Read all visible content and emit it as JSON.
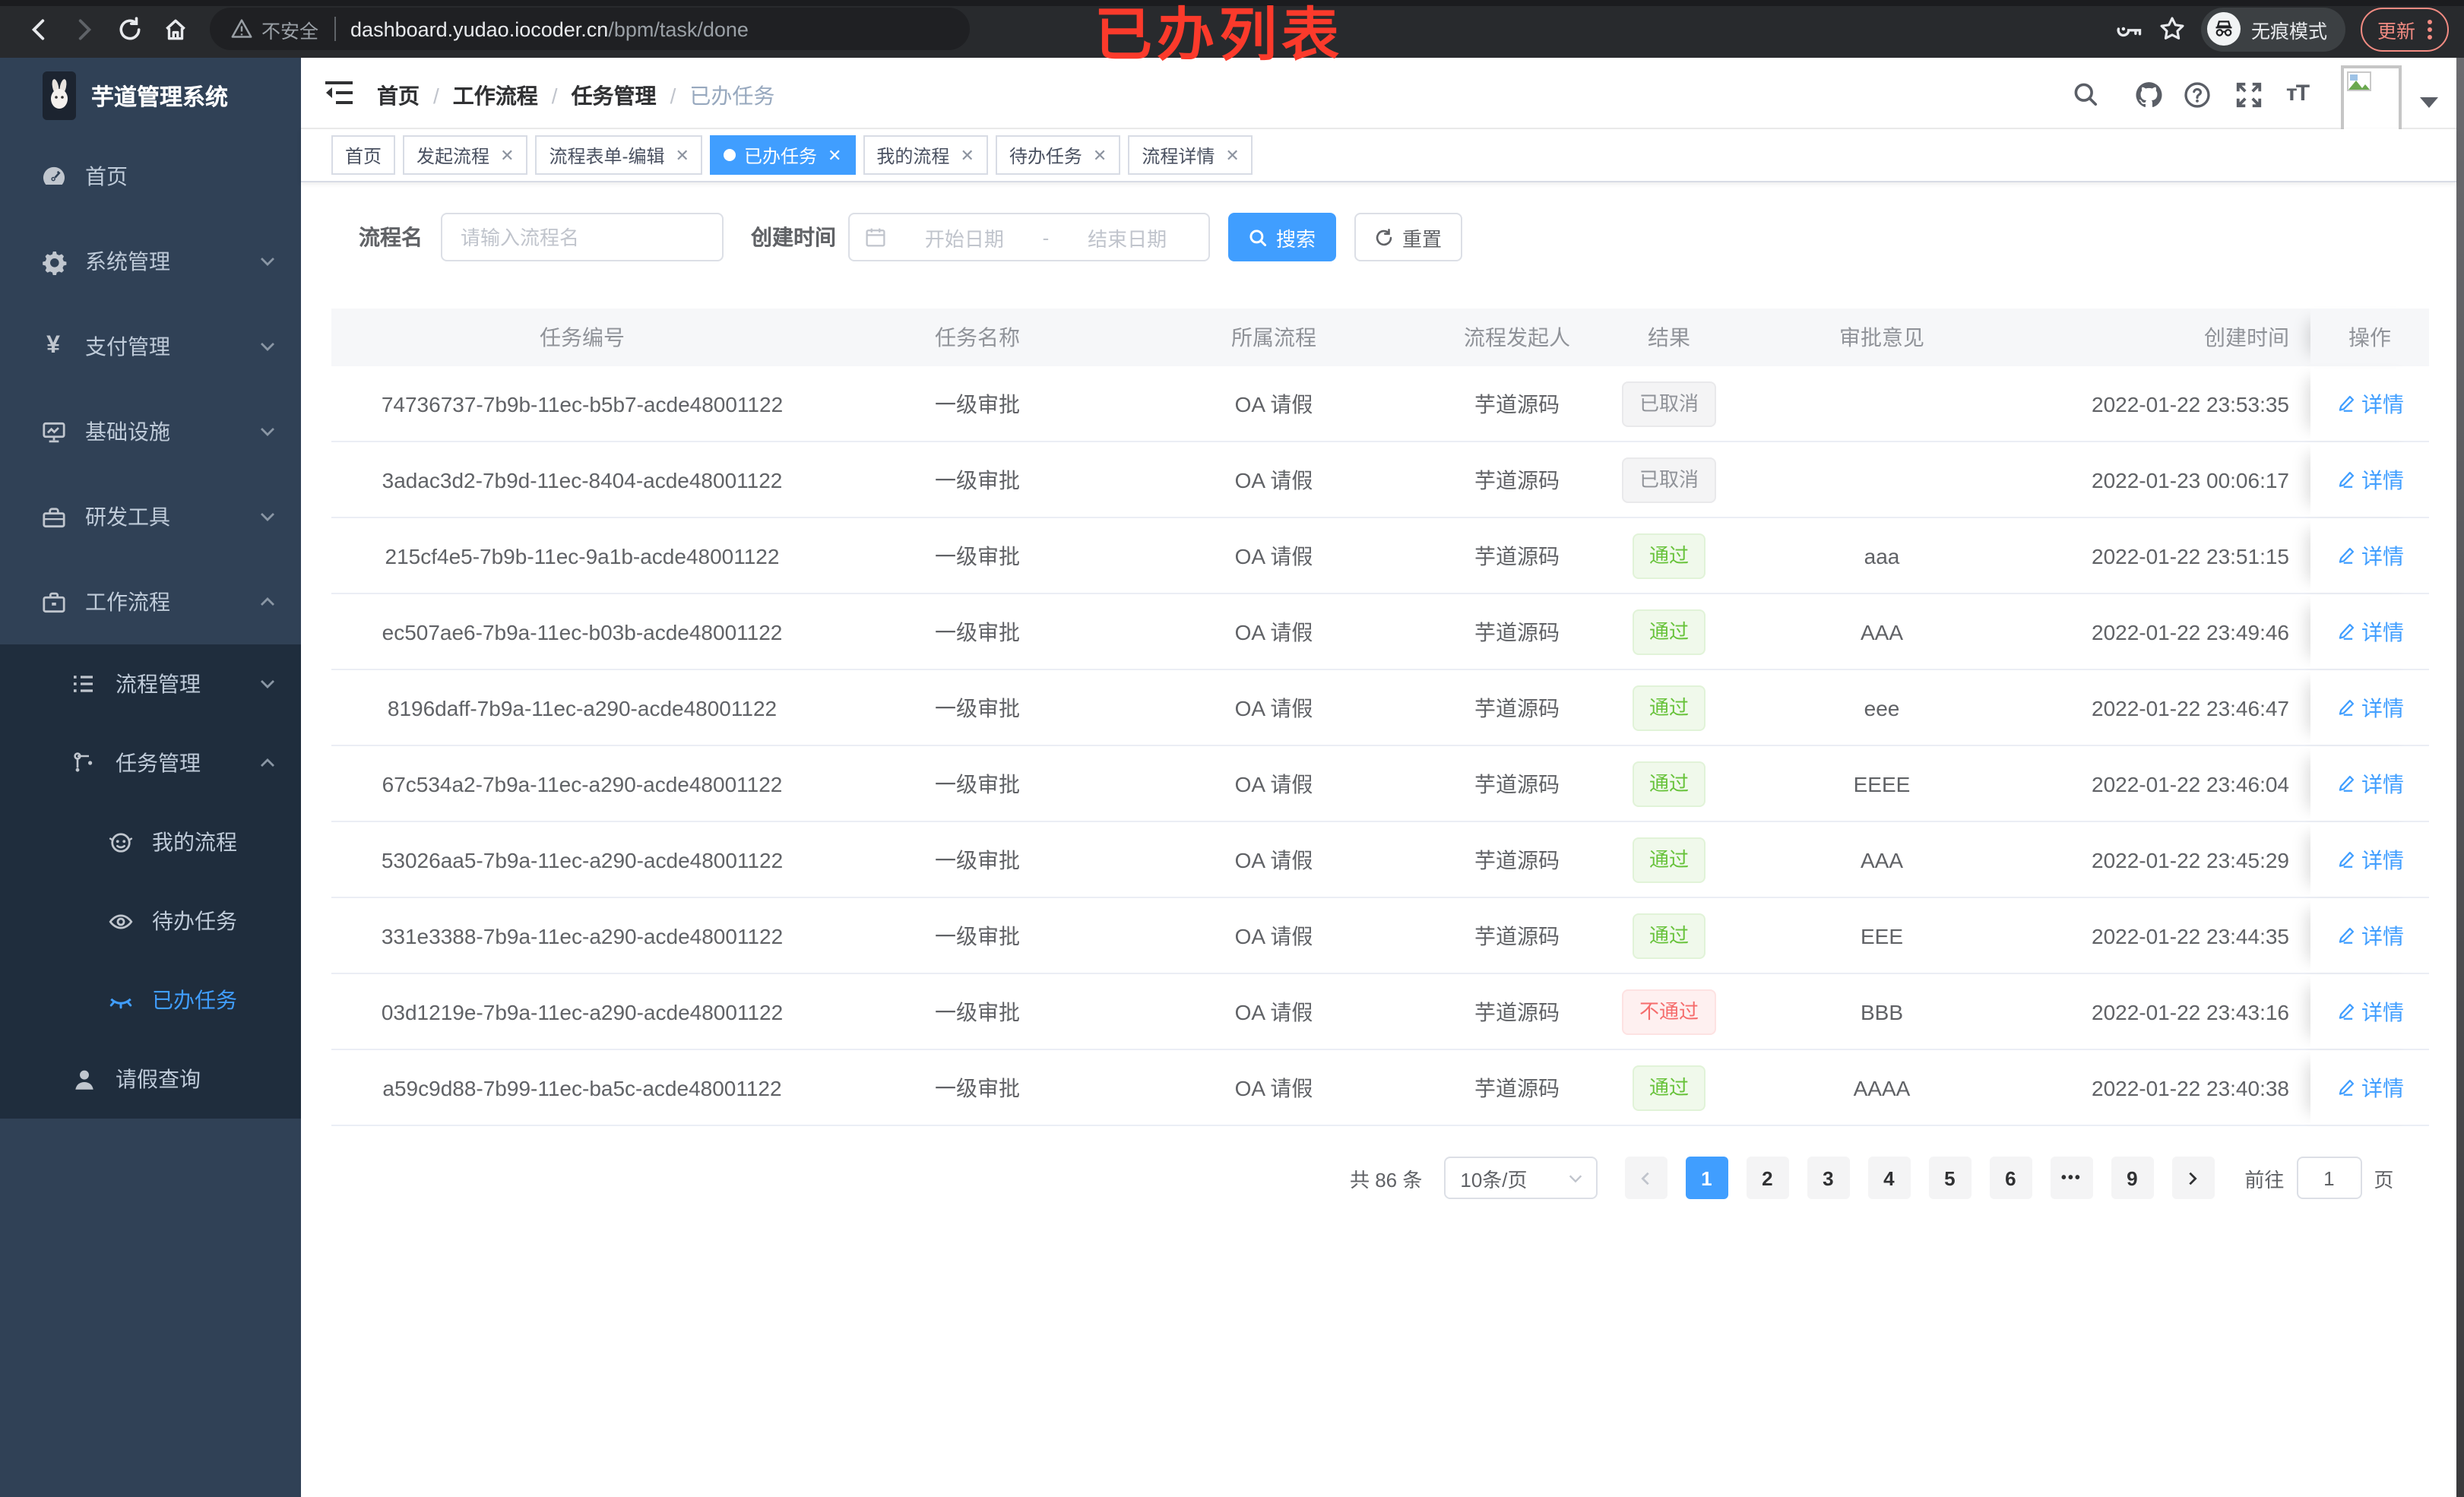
{
  "browser": {
    "security_label": "不安全",
    "url_host": "dashboard.yudao.iocoder.cn",
    "url_path": "/bpm/task/done",
    "incognito_label": "无痕模式",
    "update_label": "更新"
  },
  "annotation": {
    "text": "已办列表"
  },
  "sidebar": {
    "logo_title": "芋道管理系统",
    "items": [
      {
        "label": "首页"
      },
      {
        "label": "系统管理"
      },
      {
        "label": "支付管理"
      },
      {
        "label": "基础设施"
      },
      {
        "label": "研发工具"
      },
      {
        "label": "工作流程"
      },
      {
        "label": "流程管理"
      },
      {
        "label": "任务管理"
      },
      {
        "label": "我的流程"
      },
      {
        "label": "待办任务"
      },
      {
        "label": "已办任务"
      },
      {
        "label": "请假查询"
      }
    ]
  },
  "header": {
    "breadcrumbs": [
      "首页",
      "工作流程",
      "任务管理",
      "已办任务"
    ]
  },
  "tabs": [
    {
      "label": "首页"
    },
    {
      "label": "发起流程"
    },
    {
      "label": "流程表单-编辑"
    },
    {
      "label": "已办任务"
    },
    {
      "label": "我的流程"
    },
    {
      "label": "待办任务"
    },
    {
      "label": "流程详情"
    }
  ],
  "filters": {
    "name_label": "流程名",
    "name_placeholder": "请输入流程名",
    "time_label": "创建时间",
    "start_placeholder": "开始日期",
    "range_separator": "-",
    "end_placeholder": "结束日期",
    "search_label": "搜索",
    "reset_label": "重置"
  },
  "table": {
    "columns": [
      "任务编号",
      "任务名称",
      "所属流程",
      "流程发起人",
      "结果",
      "审批意见",
      "创建时间",
      "操作"
    ],
    "action_label": "详情",
    "rows": [
      {
        "id": "74736737-7b9b-11ec-b5b7-acde48001122",
        "name": "一级审批",
        "process": "OA 请假",
        "initiator": "芋道源码",
        "result": "已取消",
        "result_type": "info",
        "comment": "",
        "created": "2022-01-22 23:53:35"
      },
      {
        "id": "3adac3d2-7b9d-11ec-8404-acde48001122",
        "name": "一级审批",
        "process": "OA 请假",
        "initiator": "芋道源码",
        "result": "已取消",
        "result_type": "info",
        "comment": "",
        "created": "2022-01-23 00:06:17"
      },
      {
        "id": "215cf4e5-7b9b-11ec-9a1b-acde48001122",
        "name": "一级审批",
        "process": "OA 请假",
        "initiator": "芋道源码",
        "result": "通过",
        "result_type": "success",
        "comment": "aaa",
        "created": "2022-01-22 23:51:15"
      },
      {
        "id": "ec507ae6-7b9a-11ec-b03b-acde48001122",
        "name": "一级审批",
        "process": "OA 请假",
        "initiator": "芋道源码",
        "result": "通过",
        "result_type": "success",
        "comment": "AAA",
        "created": "2022-01-22 23:49:46"
      },
      {
        "id": "8196daff-7b9a-11ec-a290-acde48001122",
        "name": "一级审批",
        "process": "OA 请假",
        "initiator": "芋道源码",
        "result": "通过",
        "result_type": "success",
        "comment": "eee",
        "created": "2022-01-22 23:46:47"
      },
      {
        "id": "67c534a2-7b9a-11ec-a290-acde48001122",
        "name": "一级审批",
        "process": "OA 请假",
        "initiator": "芋道源码",
        "result": "通过",
        "result_type": "success",
        "comment": "EEEE",
        "created": "2022-01-22 23:46:04"
      },
      {
        "id": "53026aa5-7b9a-11ec-a290-acde48001122",
        "name": "一级审批",
        "process": "OA 请假",
        "initiator": "芋道源码",
        "result": "通过",
        "result_type": "success",
        "comment": "AAA",
        "created": "2022-01-22 23:45:29"
      },
      {
        "id": "331e3388-7b9a-11ec-a290-acde48001122",
        "name": "一级审批",
        "process": "OA 请假",
        "initiator": "芋道源码",
        "result": "通过",
        "result_type": "success",
        "comment": "EEE",
        "created": "2022-01-22 23:44:35"
      },
      {
        "id": "03d1219e-7b9a-11ec-a290-acde48001122",
        "name": "一级审批",
        "process": "OA 请假",
        "initiator": "芋道源码",
        "result": "不通过",
        "result_type": "danger",
        "comment": "BBB",
        "created": "2022-01-22 23:43:16"
      },
      {
        "id": "a59c9d88-7b99-11ec-ba5c-acde48001122",
        "name": "一级审批",
        "process": "OA 请假",
        "initiator": "芋道源码",
        "result": "通过",
        "result_type": "success",
        "comment": "AAAA",
        "created": "2022-01-22 23:40:38"
      }
    ]
  },
  "pagination": {
    "total_label": "共 86 条",
    "page_size_label": "10条/页",
    "pages": [
      "1",
      "2",
      "3",
      "4",
      "5",
      "6",
      "•••",
      "9"
    ],
    "goto_label": "前往",
    "goto_value": "1",
    "unit_label": "页"
  },
  "colors": {
    "accent": "#409eff",
    "success": "#67c23a",
    "danger": "#f56c6c",
    "info": "#909399",
    "sidebar_bg": "#304156",
    "submenu_bg": "#1f2d3d",
    "annotation_red": "#fb3a2b"
  }
}
